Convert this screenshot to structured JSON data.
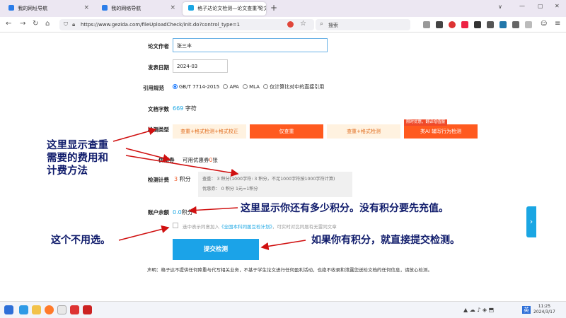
{
  "browser": {
    "tabs": [
      {
        "label": "我的网址导航"
      },
      {
        "label": "我的网络导航"
      },
      {
        "label": "格子达论文检测—论文查重 论文..."
      }
    ],
    "new_tab": "+",
    "url": "https://www.gezida.com/fileUploadCheck/init.do?control_type=1",
    "search_placeholder": "搜索",
    "window_buttons": [
      "∨",
      "—",
      "▢",
      "✕"
    ]
  },
  "form": {
    "author_label": "论文作者",
    "author_value": "张三丰",
    "date_label": "发表日期",
    "date_value": "2024-03",
    "citation_label": "引用规范",
    "citation_options": [
      "GB/T 7714-2015",
      "APA",
      "MLA",
      "仅计算比对中的直接引用"
    ],
    "wordcount_label": "文档字数",
    "wordcount_value": "669",
    "wordcount_unit": "字符",
    "checktype_label": "检测类型",
    "checktype_buttons": [
      "查重+格式检测+格式校正",
      "仅查重",
      "查重+格式检测",
      "类AI 辅写行为检测"
    ],
    "promo_badge": "限时优惠，翻译增值服",
    "coupon_label": "优惠券",
    "coupon_text": "可用优惠券",
    "coupon_count": "0",
    "coupon_unit": "张",
    "fee_label": "检测计费",
    "fee_value": "3",
    "fee_unit": "积分",
    "fee_detail_1": "查重：   3 积分(1000字符: 3 积分，不足1000字符按1000字符计算)",
    "fee_detail_2": "优惠券：    0 积分    1元=1积分",
    "balance_label": "账户余额",
    "balance_value": "0.0",
    "balance_unit": "积分",
    "agree_text": "选中表示同意加入",
    "agree_link": "《全国本科同届互检计划》",
    "agree_text_2": "，可实时对比同届有无雷同文章",
    "submit_label": "提交检测",
    "disclaimer": "声明：格子达不提供任何降重与代写相关业务，不基于学生论文进行任何盈利活动，也绝不收录和泄露您送检文档的任何信息，请放心检测。"
  },
  "annotations": {
    "fee_note": "这里显示查重\n需要的费用和\n计费方法",
    "balance_note": "这里显示你还有多少积分。没有积分要先充值。",
    "agree_note": "这个不用选。",
    "submit_note": "如果你有积分，就直接提交检测。"
  },
  "taskbar": {
    "ime": "英",
    "time": "11:25",
    "date": "2024/3/17"
  },
  "colors": {
    "accent_blue": "#1aa6e3",
    "orange_active": "#ff5a1f",
    "orange_light": "#fff2e0",
    "annotation_text": "#0f1b6b",
    "arrow_red": "#d01010"
  }
}
